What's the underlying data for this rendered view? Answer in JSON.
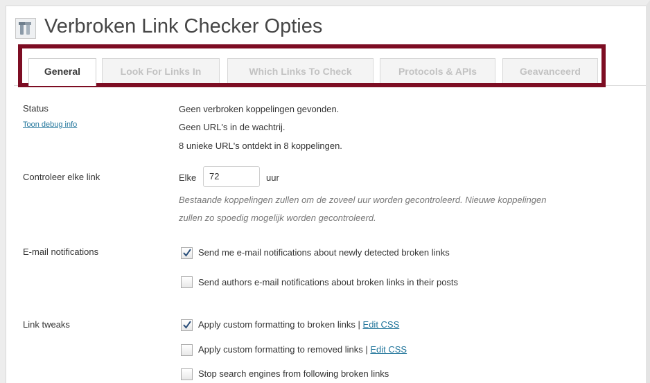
{
  "page": {
    "title": "Verbroken Link Checker Opties"
  },
  "tabs": [
    {
      "label": "General",
      "active": true
    },
    {
      "label": "Look For Links In",
      "active": false
    },
    {
      "label": "Which Links To Check",
      "active": false
    },
    {
      "label": "Protocols & APIs",
      "active": false
    },
    {
      "label": "Geavanceerd",
      "active": false
    }
  ],
  "highlight_color": "#7d0d23",
  "status": {
    "label": "Status",
    "debug_link": "Toon debug info",
    "lines": [
      "Geen verbroken koppelingen gevonden.",
      "Geen URL's in de wachtrij.",
      "8 unieke URL's ontdekt in 8 koppelingen."
    ]
  },
  "check_interval": {
    "label": "Controleer elke link",
    "prefix": "Elke",
    "value": "72",
    "unit": "uur",
    "description_line1": "Bestaande koppelingen zullen om de zoveel uur worden gecontroleerd. Nieuwe koppelingen",
    "description_line2": "zullen zo spoedig mogelijk worden gecontroleerd."
  },
  "email": {
    "label": "E-mail notifications",
    "options": [
      {
        "label": "Send me e-mail notifications about newly detected broken links",
        "checked": true
      },
      {
        "label": "Send authors e-mail notifications about broken links in their posts",
        "checked": false
      }
    ]
  },
  "link_tweaks": {
    "label": "Link tweaks",
    "options": [
      {
        "label": "Apply custom formatting to broken links",
        "separator": "|",
        "link": "Edit CSS",
        "checked": true
      },
      {
        "label": "Apply custom formatting to removed links",
        "separator": "|",
        "link": "Edit CSS",
        "checked": false
      },
      {
        "label": "Stop search engines from following broken links",
        "checked": false
      }
    ]
  },
  "icons": {
    "page": "tools-icon",
    "check": "checkmark-icon"
  },
  "colors": {
    "link": "#21759b",
    "tab_active_text": "#3a3a3a",
    "tab_inactive_text": "#c2c2c2"
  }
}
